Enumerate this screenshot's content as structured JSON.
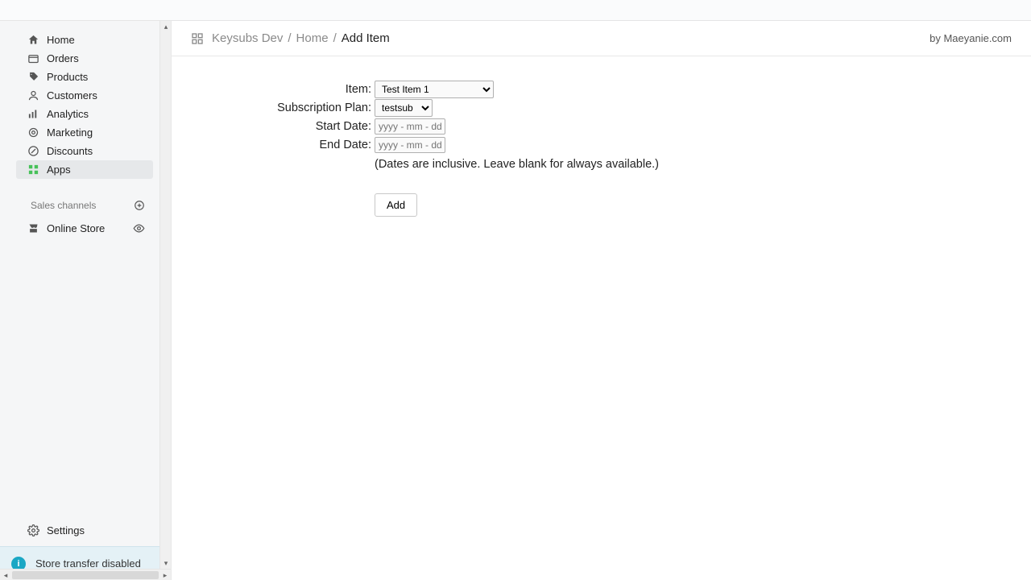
{
  "sidebar": {
    "items": [
      {
        "label": "Home",
        "icon": "home"
      },
      {
        "label": "Orders",
        "icon": "orders"
      },
      {
        "label": "Products",
        "icon": "tag"
      },
      {
        "label": "Customers",
        "icon": "user"
      },
      {
        "label": "Analytics",
        "icon": "analytics"
      },
      {
        "label": "Marketing",
        "icon": "target"
      },
      {
        "label": "Discounts",
        "icon": "discount"
      },
      {
        "label": "Apps",
        "icon": "apps",
        "active": true
      }
    ],
    "section_label": "Sales channels",
    "sub": {
      "label": "Online Store"
    },
    "settings": "Settings",
    "notice": "Store transfer disabled"
  },
  "breadcrumb": {
    "app": "Keysubs Dev",
    "home": "Home",
    "current": "Add Item",
    "byline": "by Maeyanie.com"
  },
  "form": {
    "item_label": "Item:",
    "item_value": "Test Item 1",
    "plan_label": "Subscription Plan:",
    "plan_value": "testsub",
    "start_label": "Start Date:",
    "end_label": "End Date:",
    "date_placeholder": "yyyy - mm - dd",
    "hint": "(Dates are inclusive. Leave blank for always available.)",
    "add_btn": "Add"
  }
}
